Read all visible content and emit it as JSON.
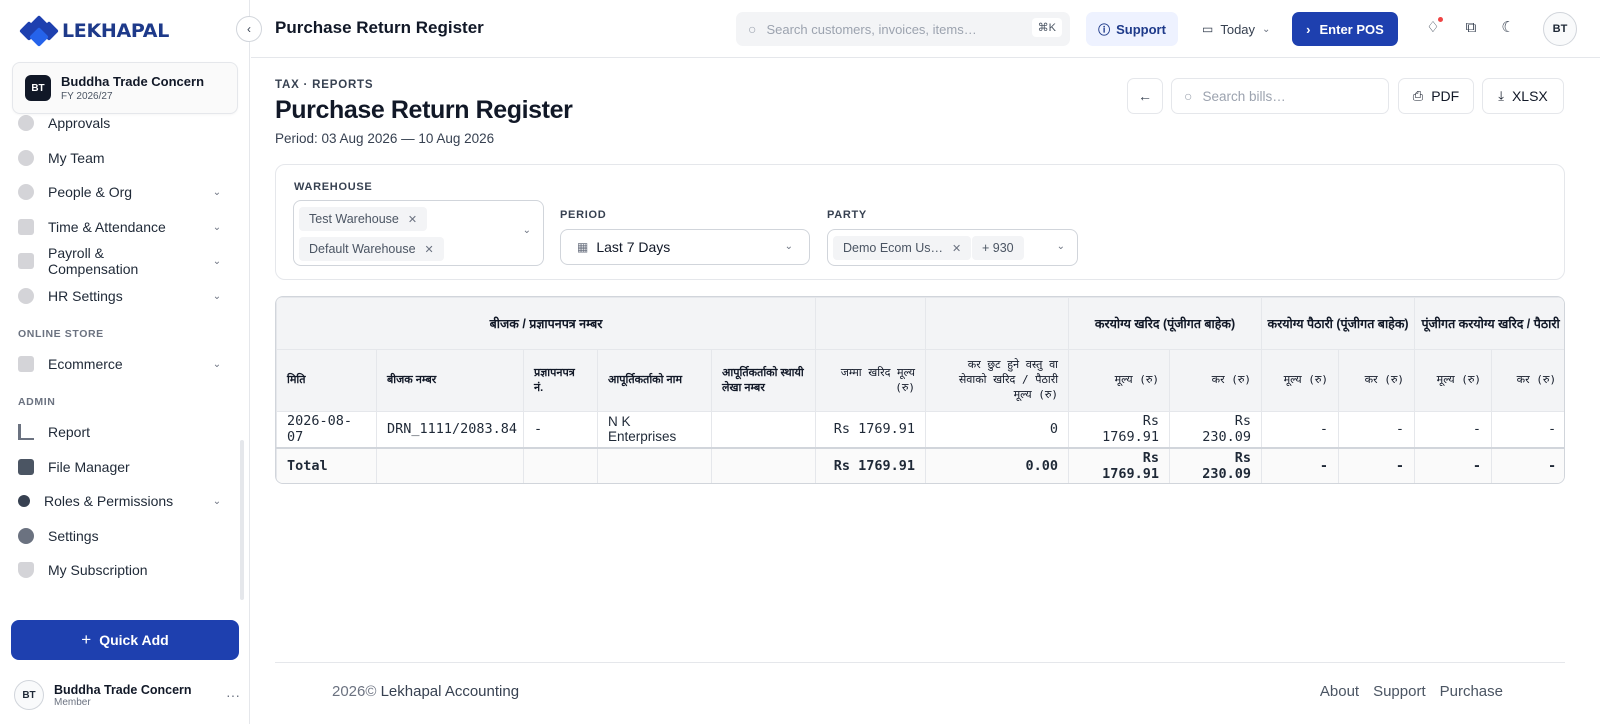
{
  "brand": {
    "name": "LEKHAPAL"
  },
  "org": {
    "initials": "BT",
    "name": "Buddha Trade Concern",
    "fy": "FY 2026/27"
  },
  "sidebar": {
    "items": [
      {
        "label": "Approvals",
        "icon": "approvals-icon",
        "chevron": false
      },
      {
        "label": "My Team",
        "icon": "team-icon",
        "chevron": false
      },
      {
        "label": "People & Org",
        "icon": "people-icon",
        "chevron": true
      },
      {
        "label": "Time & Attendance",
        "icon": "calendar-icon",
        "chevron": true
      },
      {
        "label": "Payroll & Compensation",
        "icon": "payroll-icon",
        "chevron": true
      },
      {
        "label": "HR Settings",
        "icon": "gear-icon",
        "chevron": true
      }
    ],
    "section_store": "ONLINE STORE",
    "store_items": [
      {
        "label": "Ecommerce",
        "icon": "store-icon",
        "chevron": true
      }
    ],
    "section_admin": "ADMIN",
    "admin_items": [
      {
        "label": "Report",
        "icon": "report-icon",
        "chevron": false
      },
      {
        "label": "File Manager",
        "icon": "folder-icon",
        "chevron": false
      },
      {
        "label": "Roles & Permissions",
        "icon": "key-icon",
        "chevron": true
      },
      {
        "label": "Settings",
        "icon": "settings-icon",
        "chevron": false
      },
      {
        "label": "My Subscription",
        "icon": "shield-icon",
        "chevron": false
      }
    ],
    "quick_add": "Quick Add",
    "user": {
      "initials": "BT",
      "name": "Buddha Trade Concern",
      "role": "Member"
    }
  },
  "topbar": {
    "title": "Purchase Return Register",
    "search_placeholder": "Search customers, invoices, items…",
    "shortcut": "⌘K",
    "support": "Support",
    "today": "Today",
    "enter_pos": "Enter POS",
    "avatar": "BT"
  },
  "page": {
    "breadcrumb": "TAX · REPORTS",
    "title": "Purchase Return Register",
    "period": "Period: 03 Aug 2026 — 10 Aug 2026",
    "bill_search_placeholder": "Search bills…",
    "pdf": "PDF",
    "xlsx": "XLSX"
  },
  "filters": {
    "warehouse_label": "WAREHOUSE",
    "warehouses": [
      "Test Warehouse",
      "Default Warehouse"
    ],
    "period_label": "PERIOD",
    "period_value": "Last 7 Days",
    "party_label": "PARTY",
    "party_chip": "Demo Ecom Us…",
    "party_more": "+ 930"
  },
  "table": {
    "group_headers": [
      "बीजक / प्रज्ञापनपत्र नम्बर",
      "करयोग्य खरिद (पूंजीगत बाहेक)",
      "करयोग्य पैठारी (पूंजीगत बाहेक)",
      "पूंजीगत करयोग्य खरिद / पैठारी"
    ],
    "columns": [
      "मिति",
      "बीजक नम्बर",
      "प्रज्ञापनपत्र नं.",
      "आपूर्तिकर्ताको नाम",
      "आपूर्तिकर्ताको स्थायी लेखा नम्बर",
      "जम्मा खरिद मूल्य (रु)",
      "कर छुट हुने वस्तु वा सेवाको खरिद / पैठारी मूल्य (रु)",
      "मूल्य (रु)",
      "कर (रु)",
      "मूल्य (रु)",
      "कर (रु)",
      "मूल्य (रु)",
      "कर (रु)"
    ],
    "rows": [
      {
        "date": "2026-08-07",
        "invoice": "DRN_1111/2083.84",
        "pragyapan": "-",
        "supplier": "N K Enterprises",
        "pan": "",
        "total": "Rs 1769.91",
        "exempt": "0",
        "tx_value": "Rs 1769.91",
        "tx_tax": "Rs 230.09",
        "imp_value": "-",
        "imp_tax": "-",
        "cap_value": "-",
        "cap_tax": "-"
      }
    ],
    "total": {
      "label": "Total",
      "total": "Rs 1769.91",
      "exempt": "0.00",
      "tx_value": "Rs 1769.91",
      "tx_tax": "Rs 230.09",
      "imp_value": "-",
      "imp_tax": "-",
      "cap_value": "-",
      "cap_tax": "-"
    }
  },
  "footer": {
    "year": "2026©",
    "company": "Lekhapal Accounting",
    "links": [
      "About",
      "Support",
      "Purchase"
    ]
  }
}
